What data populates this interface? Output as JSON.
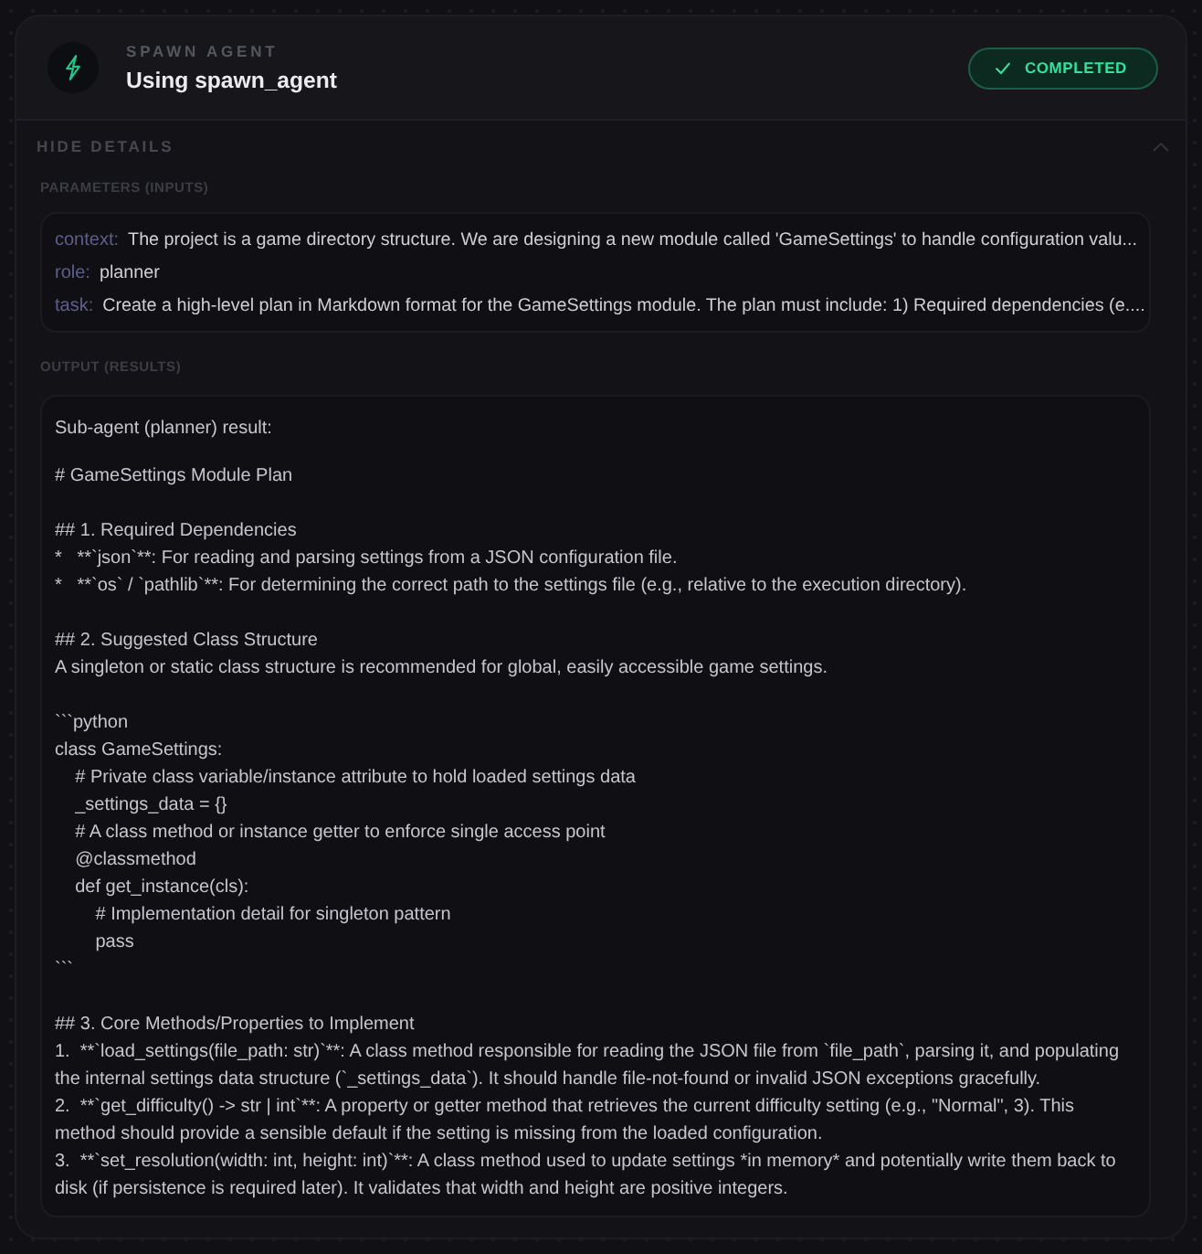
{
  "tool": {
    "category": "SPAWN AGENT",
    "title": "Using spawn_agent",
    "status": {
      "label": "COMPLETED",
      "kind": "success"
    }
  },
  "details": {
    "toggle_label": "HIDE DETAILS",
    "expanded": true
  },
  "parameters": {
    "heading": "PARAMETERS (INPUTS)",
    "items": [
      {
        "key": "context:",
        "value": "The project is a game directory structure. We are designing a new module called 'GameSettings' to handle configuration valu..."
      },
      {
        "key": "role:",
        "value": "planner"
      },
      {
        "key": "task:",
        "value": "Create a high-level plan in Markdown format for the GameSettings module. The plan must include: 1) Required dependencies (e...."
      }
    ]
  },
  "output": {
    "heading": "OUTPUT (RESULTS)",
    "blocks": [
      {
        "lines": [
          "Sub-agent (planner) result:"
        ]
      },
      {
        "lines": [
          "# GameSettings Module Plan"
        ]
      },
      {
        "lines": [
          "## 1. Required Dependencies",
          "*   **`json`**: For reading and parsing settings from a JSON configuration file.",
          "*   **`os` / `pathlib`**: For determining the correct path to the settings file (e.g., relative to the execution directory)."
        ]
      },
      {
        "lines": [
          "## 2. Suggested Class Structure",
          "A singleton or static class structure is recommended for global, easily accessible game settings."
        ]
      },
      {
        "lines": [
          "```python",
          "class GameSettings:",
          "    # Private class variable/instance attribute to hold loaded settings data",
          "    _settings_data = {}",
          "    # A class method or instance getter to enforce single access point",
          "    @classmethod",
          "    def get_instance(cls):",
          "        # Implementation detail for singleton pattern",
          "        pass",
          "```"
        ]
      },
      {
        "lines": [
          "## 3. Core Methods/Properties to Implement",
          "1.  **`load_settings(file_path: str)`**: A class method responsible for reading the JSON file from `file_path`, parsing it, and populating the internal settings data structure (`_settings_data`). It should handle file-not-found or invalid JSON exceptions gracefully.",
          "2.  **`get_difficulty() -> str | int`**: A property or getter method that retrieves the current difficulty setting (e.g., \"Normal\", 3). This method should provide a sensible default if the setting is missing from the loaded configuration.",
          "3.  **`set_resolution(width: int, height: int)`**: A class method used to update settings *in memory* and potentially write them back to disk (if persistence is required later). It validates that width and height are positive integers."
        ]
      }
    ]
  }
}
